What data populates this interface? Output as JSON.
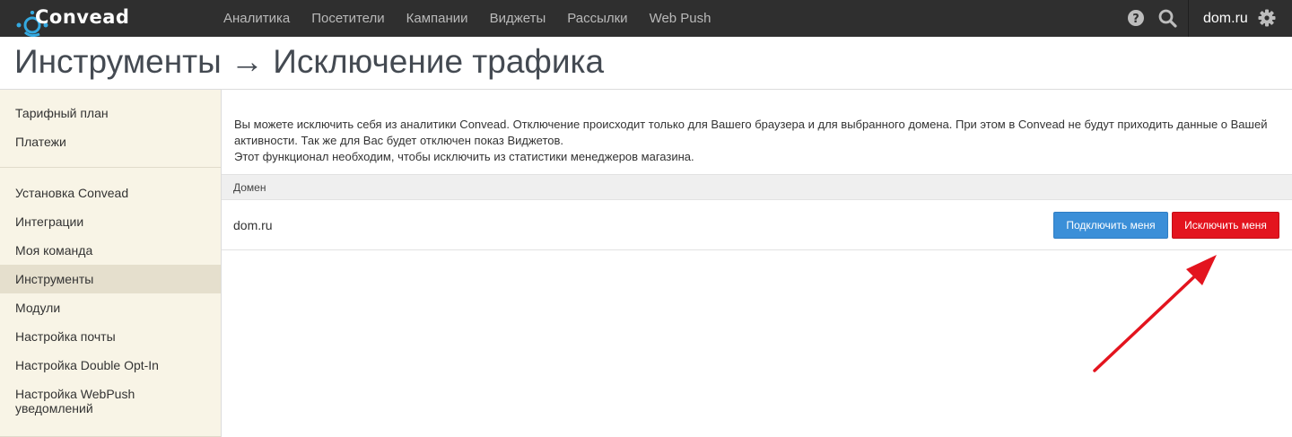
{
  "app": {
    "logo_text": "Convead",
    "nav": [
      "Аналитика",
      "Посетители",
      "Кампании",
      "Виджеты",
      "Рассылки",
      "Web Push"
    ],
    "account": "dom.ru",
    "icons": [
      "help-icon",
      "search-icon",
      "gear-icon"
    ]
  },
  "page": {
    "title": "Инструменты → Исключение трафика"
  },
  "sidebar": {
    "group1": [
      "Тарифный план",
      "Платежи"
    ],
    "group2": [
      "Установка Convead",
      "Интеграции",
      "Моя команда",
      "Инструменты",
      "Модули",
      "Настройка почты",
      "Настройка Double Opt-In",
      "Настройка WebPush уведомлений"
    ],
    "active": "Инструменты"
  },
  "main": {
    "info_line1": "Вы можете исключить себя из аналитики Convead. Отключение происходит только для Вашего браузера и для выбранного домена. При этом в Convead не будут приходить данные о Вашей активности. Так же для Вас будет отключен показ Виджетов.",
    "info_line2": "Этот функционал необходим, чтобы исключить из статистики менеджеров магазина.",
    "table_header": "Домен",
    "rows": [
      {
        "domain": "dom.ru",
        "enable_label": "Подключить меня",
        "exclude_label": "Исключить меня"
      }
    ]
  },
  "colors": {
    "topbar": "#2f2f2f",
    "sidebar_bg": "#f8f4e6",
    "sidebar_active": "#e5dfcd",
    "primary": "#3b8fd8",
    "danger": "#e3141e",
    "annotation_arrow": "#e3141e"
  }
}
